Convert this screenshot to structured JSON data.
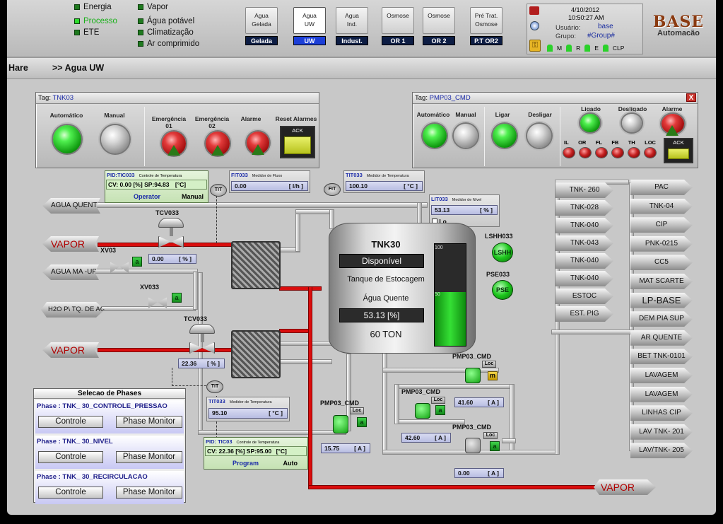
{
  "topbar": {
    "categories": [
      {
        "label": "Energia",
        "active": false
      },
      {
        "label": "Processo",
        "active": true
      },
      {
        "label": "ETE",
        "active": false
      },
      {
        "label": "Vapor",
        "active": false
      },
      {
        "label": "Água potável",
        "active": false
      },
      {
        "label": "Climatização",
        "active": false
      },
      {
        "label": "Ar comprimido",
        "active": false
      }
    ],
    "nav": [
      {
        "line1": "Agua",
        "line2": "Gelada",
        "tag": "Gelada"
      },
      {
        "line1": "Agua",
        "line2": "UW",
        "tag": "UW"
      },
      {
        "line1": "Agua",
        "line2": "Ind.",
        "tag": "Indust."
      },
      {
        "line1": "Osmose",
        "line2": "",
        "tag": "OR 1"
      },
      {
        "line1": "Osmose",
        "line2": "",
        "tag": "OR 2"
      },
      {
        "line1": "Pré Trat.",
        "line2": "Osmose",
        "tag": "P.T OR2"
      }
    ],
    "user": {
      "date": "4/10/2012",
      "time": "10:50:27 AM",
      "user_label": "Usuário:",
      "user": "base",
      "group_label": "Grupo:",
      "group": "#Group#",
      "status": [
        "M",
        "R",
        "E",
        "CLP"
      ]
    },
    "logo": {
      "top": "BASE",
      "bottom": "Automacão"
    }
  },
  "breadcrumb": {
    "root": "Hare",
    "current": ">> Agua UW"
  },
  "panel_tnk": {
    "tag_label": "Tag:",
    "tag": "TNK03",
    "labels": {
      "auto": "Automático",
      "manual": "Manual",
      "em1": "Emergência\n01",
      "em2": "Emergência\n02",
      "alarm": "Alarme",
      "reset": "Reset Alarmes",
      "ack": "ACK"
    }
  },
  "panel_pmp": {
    "tag_label": "Tag:",
    "tag": "PMP03_CMD",
    "close": "X",
    "labels": {
      "auto": "Automático",
      "manual": "Manual",
      "ligar": "Ligar",
      "desligar": "Desligar",
      "ligado": "Ligado",
      "desligado": "Desligado",
      "alarm": "Alarme",
      "ack": "ACK"
    },
    "status": [
      "IL",
      "OR",
      "FL",
      "FB",
      "TH",
      "LOC"
    ]
  },
  "instruments": {
    "pid033": {
      "tag": "PID:TIC033",
      "desc": "Controle de Temperatura",
      "cv": "CV: 0.00",
      "sp_u": "[%]",
      "sp": "SP:94.83",
      "unit": "[°C]",
      "mode": "Operator",
      "mode2": "Manual"
    },
    "fit033": {
      "tag": "FIT033",
      "desc": "Medidor de Fluxo",
      "value": "0.00",
      "unit": "[ l/h ]"
    },
    "tit033a": {
      "tag": "TIT033",
      "desc": "Medidor de Temperatura",
      "value": "100.10",
      "unit": "[ °C ]"
    },
    "lit033": {
      "tag": "LIT033",
      "desc": "Medidor de Nível",
      "value": "53.13",
      "unit": "[ % ]",
      "lo": "Lo"
    },
    "tit033b": {
      "tag": "TIT033",
      "desc": "Medidor de Temperatura",
      "value": "95.10",
      "unit": "[ °C ]"
    },
    "pid03": {
      "tag": "PID: TIC03",
      "desc": "Controle de Temperatura",
      "cv": "CV: 22.36",
      "sp_u": "[%]",
      "sp": "SP:95.00",
      "unit": "[°C]",
      "mode": "Program",
      "mode2": "Auto"
    },
    "circles": {
      "tit1": "TIT",
      "fit": "FIT",
      "tit2": "TIT"
    }
  },
  "valves": {
    "tcv1": {
      "label": "TCV033",
      "value": "0.00",
      "unit": "[ % ]"
    },
    "xv03": {
      "label": "XV03",
      "btn": "a"
    },
    "xv033": {
      "label": "XV033",
      "btn": "a"
    },
    "tcv2": {
      "label": "TCV033",
      "value": "22.36",
      "unit": "[ % ]"
    }
  },
  "sources": {
    "agua_quente": "AGUA QUENTE",
    "vapor1": "VAPOR",
    "agua_ma": "AGUA MA     -UP",
    "h2o": "H2O P\\ TQ. DE AGUA",
    "vapor2": "VAPOR",
    "vapor_out": "VAPOR"
  },
  "tank": {
    "name": "TNK30",
    "status": "Disponível",
    "desc1": "Tanque de Estocagem",
    "desc2": "Água Quente",
    "value": "53.13   [%]",
    "capacity": "60 TON",
    "scale_top": "100",
    "scale_mid": "50",
    "level_percent": 53.13
  },
  "switches": {
    "lshh": "LSHH033",
    "lshh_btn": "LSHH",
    "pse": "PSE033",
    "pse_btn": "PSE"
  },
  "pumps": [
    {
      "label": "PMP03_CMD",
      "loc": "Loc",
      "btn": "m",
      "value": "41.60",
      "unit": "[ A ]"
    },
    {
      "label": "PMP03_CMD",
      "loc": "Loc",
      "btn": "a",
      "value": "42.60",
      "unit": "[ A ]"
    },
    {
      "label": "PMP03_CMD",
      "loc": "Loc",
      "btn": "a",
      "value": "0.00",
      "unit": "[ A ]"
    },
    {
      "label": "PMP03_CMD",
      "loc": "Loc",
      "btn": "a",
      "value": "15.75",
      "unit": "[ A ]"
    }
  ],
  "phases": {
    "title": "Selecao de Phases",
    "rows": [
      {
        "name": "Phase :  TNK_     30_CONTROLE_PRESSAO",
        "btn1": "Controle",
        "btn2": "Phase Monitor"
      },
      {
        "name": "Phase :  TNK_     30_NIVEL",
        "btn1": "Controle",
        "btn2": "Phase Monitor"
      },
      {
        "name": "Phase :  TNK_     30_RECIRCULACAO",
        "btn1": "Controle",
        "btn2": "Phase Monitor"
      }
    ]
  },
  "dest_left": [
    "TNK-      260",
    "TNK-028",
    "TNK-040",
    "TNK-043",
    "TNK-040",
    "TNK-040",
    "ESTOC",
    "EST. PIG"
  ],
  "dest_right": [
    "PAC",
    "TNK-04",
    "CIP",
    "PNK-0215",
    "CC5",
    "MAT SCARTE",
    "LP-BASE",
    "DEM PIA SUP",
    "AR QUENTE",
    "BET   TNK-0101",
    "LAVAGEM",
    "LAVAGEM",
    "LINHAS CIP",
    "LAV TNK-  201",
    "LAV/TNK-  205"
  ]
}
